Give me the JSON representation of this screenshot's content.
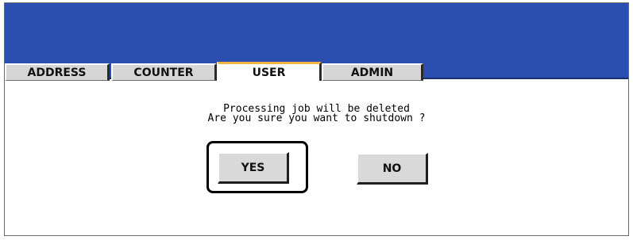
{
  "tabs": [
    {
      "label": "ADDRESS",
      "active": false
    },
    {
      "label": "COUNTER",
      "active": false
    },
    {
      "label": "USER",
      "active": true
    },
    {
      "label": "ADMIN",
      "active": false
    }
  ],
  "dialog": {
    "message_line1": "Processing job will be deleted",
    "message_line2": "Are you sure you want to shutdown ?",
    "yes_label": "YES",
    "no_label": "NO"
  },
  "colors": {
    "header": "#2a4fb0",
    "active_tab_accent": "#f2b544",
    "button_face": "#d9d9d9"
  }
}
